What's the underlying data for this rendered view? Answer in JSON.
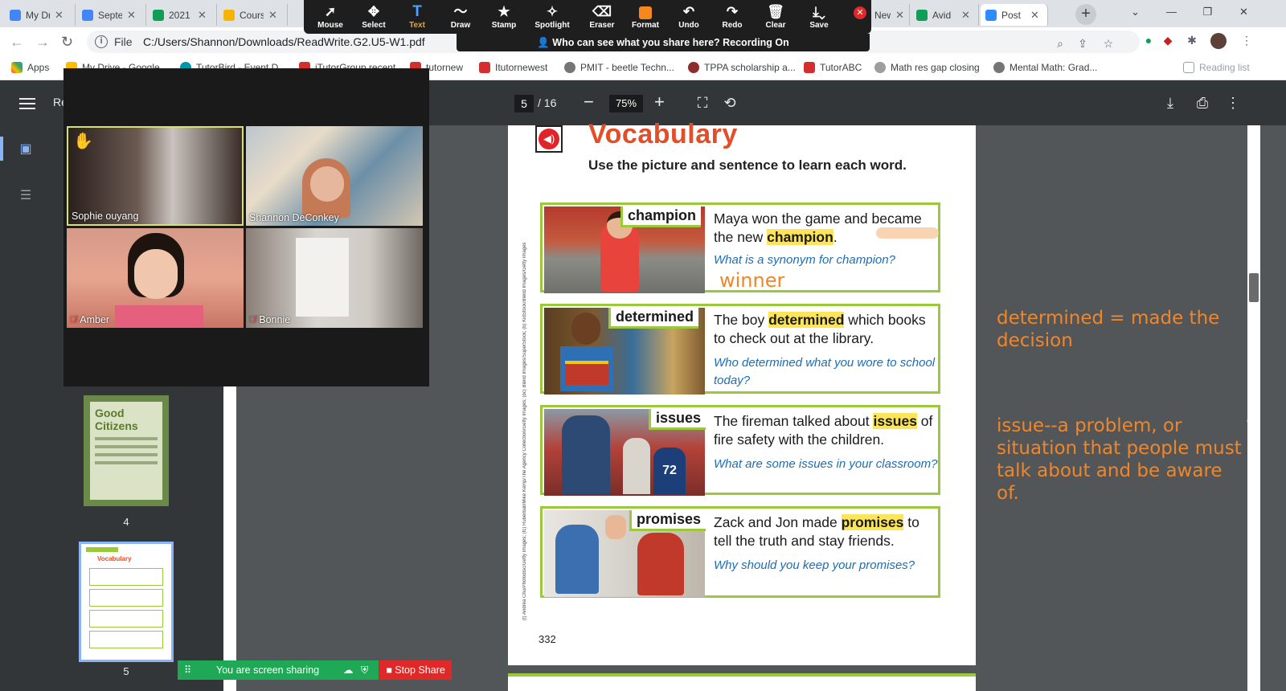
{
  "tabs": [
    {
      "label": "My Drive",
      "color": "#4285f4"
    },
    {
      "label": "September",
      "color": "#4285f4"
    },
    {
      "label": "2021",
      "color": "#0f9d58"
    },
    {
      "label": "Course",
      "color": "#f4b400"
    },
    {
      "label": "",
      "color": "#f4b400"
    },
    {
      "label": "New",
      "color": "#4285f4"
    },
    {
      "label": "Avid",
      "color": "#0f9d58"
    },
    {
      "label": "Post",
      "color": "#2d8cff"
    }
  ],
  "address": {
    "scheme": "File",
    "url": "C:/Users/Shannon/Downloads/ReadWrite.G2.U5-W1.pdf"
  },
  "bookmarks": [
    "Apps",
    "My Drive - Google...",
    "TutorBird - Event D...",
    "iTutorGroup recent",
    "tutornew",
    "Itutornewest",
    "PMIT - beetle Techn...",
    "TPPA scholarship a...",
    "TutorABC",
    "Math res gap closing",
    "Mental Math: Grad...",
    "Reading list"
  ],
  "pdf": {
    "title": "Re",
    "page": "5",
    "total": "/ 16",
    "zoom": "75%"
  },
  "zoom_toolbar": [
    "Mouse",
    "Select",
    "Text",
    "Draw",
    "Stamp",
    "Spotlight",
    "Eraser",
    "Format",
    "Undo",
    "Redo",
    "Clear",
    "Save"
  ],
  "zoom_recording": "Who can see what you share here? Recording On",
  "participants": [
    "Sophie ouyang",
    "Shannon DeConkey",
    "Amber",
    "Bonnie"
  ],
  "share": {
    "status": "You are screen sharing",
    "stop": "Stop Share"
  },
  "thumbnails": [
    {
      "num": "4",
      "title": "Good Citizens"
    },
    {
      "num": "5",
      "title": "Vocabulary"
    }
  ],
  "page": {
    "title": "Vocabulary",
    "subtitle": "Use the picture and sentence to learn each word.",
    "number": "332",
    "credit": "(t) Andrea Chu/Photodisc/Getty Images; (tc) Ruberball/Mike Kemp/The Agency Collection/Getty Images; (bc) Blend Images/SuperStock; (b) KidStock/Blend Images/Getty Images",
    "cards": [
      {
        "word": "champion",
        "pre": "Maya won the game and became the new ",
        "hl": "champion",
        "post": ".",
        "question": "What is a synonym for champion?"
      },
      {
        "word": "determined",
        "pre": "The boy ",
        "hl": "determined",
        "post": " which books to check out at the library.",
        "question": "Who determined what you wore to school today?"
      },
      {
        "word": "issues",
        "pre": "The fireman talked about ",
        "hl": "issues",
        "post": " of fire safety with the children.",
        "question": "What are some issues in your classroom?"
      },
      {
        "word": "promises",
        "pre": "Zack and Jon made ",
        "hl": "promises",
        "post": " to tell the truth and stay friends.",
        "question": "Why should you keep your promises?"
      }
    ]
  },
  "annotations": {
    "winner": "winner",
    "determined": "determined = made the decision",
    "issue": "issue--a problem, or situation that people must talk about and be aware of.",
    "stray": "w"
  },
  "colors": {
    "annotation": "#f0862a",
    "card_border": "#9bc93b",
    "title": "#e34d27",
    "question": "#1e6db3",
    "highlight": "#fde55b"
  }
}
